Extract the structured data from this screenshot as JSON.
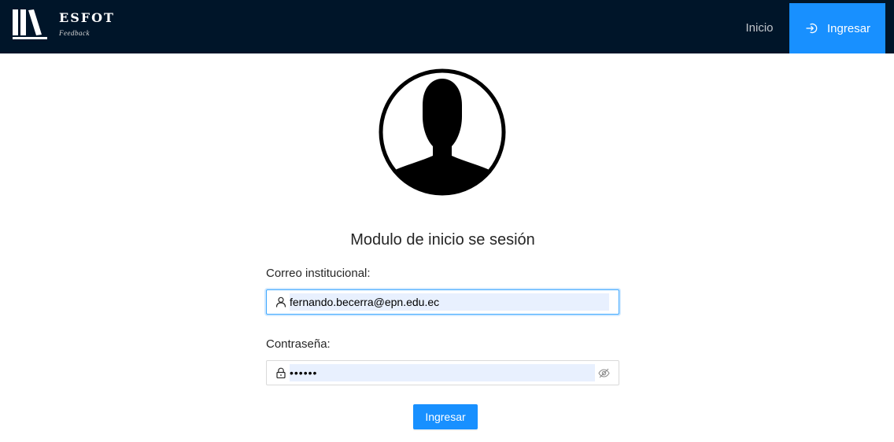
{
  "header": {
    "brand_name": "ESFOT",
    "brand_subtitle": "Feedback",
    "nav": {
      "home_label": "Inicio",
      "login_label": "Ingresar",
      "login_icon": "login-icon"
    },
    "logo_icon": "books-logo"
  },
  "main": {
    "avatar_icon": "user-silhouette-avatar",
    "title": "Modulo de inicio se sesión",
    "email": {
      "label": "Correo institucional:",
      "value": "fernando.becerra@epn.edu.ec",
      "prefix_icon": "user-icon"
    },
    "password": {
      "label": "Contraseña:",
      "value": "••••••",
      "prefix_icon": "lock-icon",
      "suffix_icon": "eye-invisible-icon"
    },
    "submit_label": "Ingresar"
  },
  "colors": {
    "header_bg": "#001529",
    "primary": "#1890ff",
    "autofill_bg": "#e8f0fe"
  }
}
